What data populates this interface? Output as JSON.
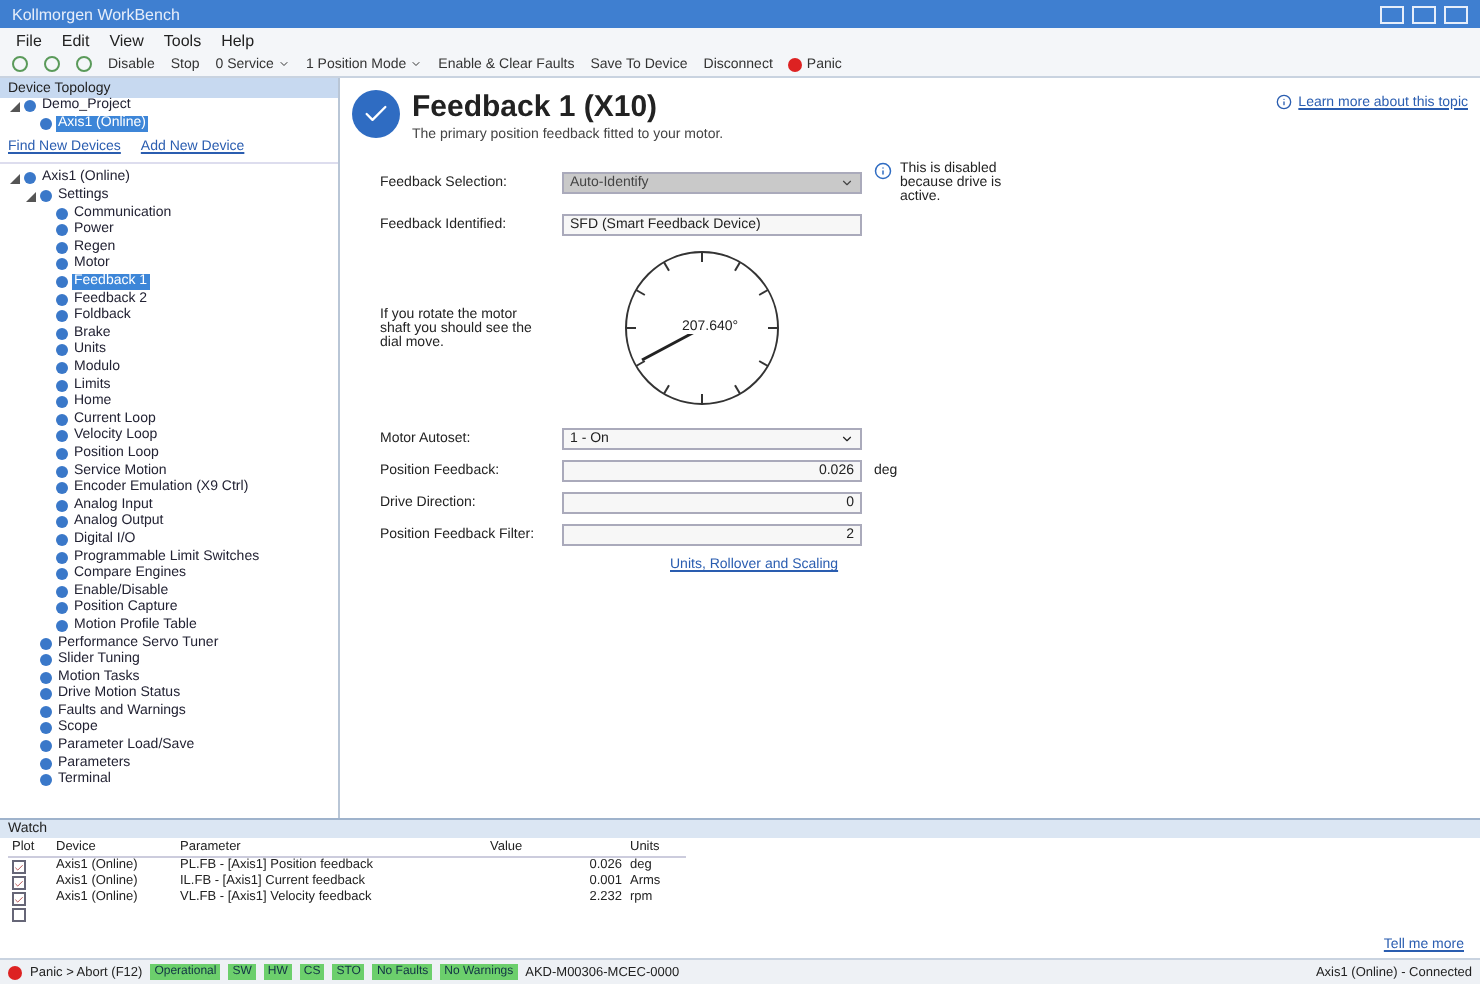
{
  "window": {
    "title": "Kollmorgen WorkBench"
  },
  "menu": [
    "File",
    "Edit",
    "View",
    "Tools",
    "Help"
  ],
  "toolbar": [
    {
      "label": "Disable",
      "kind": "text"
    },
    {
      "label": "Stop",
      "kind": "text"
    },
    {
      "label": "0 Service",
      "kind": "dropdown"
    },
    {
      "label": "1 Position Mode",
      "kind": "dropdown"
    },
    {
      "label": "Enable & Clear Faults",
      "kind": "text"
    },
    {
      "label": "Save To Device",
      "kind": "text"
    },
    {
      "label": "Disconnect",
      "kind": "text"
    },
    {
      "label": "Panic",
      "kind": "panic"
    }
  ],
  "sidebar": {
    "title": "Device Topology",
    "project": [
      {
        "label": "Demo_Project",
        "selected": false,
        "expanded": true,
        "children": [
          {
            "label": "Axis1 (Online)",
            "selected": true,
            "expanded": false
          }
        ]
      }
    ],
    "links": [
      "Find New Devices",
      "Add New Device"
    ],
    "tree": [
      {
        "label": "Axis1 (Online)",
        "selected": false,
        "expanded": true,
        "children": [
          {
            "label": "Settings",
            "selected": false,
            "expanded": true,
            "children": [
              {
                "label": "Communication",
                "selected": false,
                "expanded": false
              },
              {
                "label": "Power",
                "selected": false,
                "expanded": false
              },
              {
                "label": "Regen",
                "selected": false,
                "expanded": false
              },
              {
                "label": "Motor",
                "selected": false,
                "expanded": false
              },
              {
                "label": "Feedback 1",
                "selected": true,
                "expanded": false
              },
              {
                "label": "Feedback 2",
                "selected": false,
                "expanded": false
              },
              {
                "label": "Foldback",
                "selected": false,
                "expanded": false
              },
              {
                "label": "Brake",
                "selected": false,
                "expanded": false
              },
              {
                "label": "Units",
                "selected": false,
                "expanded": false
              },
              {
                "label": "Modulo",
                "selected": false,
                "expanded": false
              },
              {
                "label": "Limits",
                "selected": false,
                "expanded": false
              },
              {
                "label": "Home",
                "selected": false,
                "expanded": false
              },
              {
                "label": "Current Loop",
                "selected": false,
                "expanded": false
              },
              {
                "label": "Velocity Loop",
                "selected": false,
                "expanded": false
              },
              {
                "label": "Position Loop",
                "selected": false,
                "expanded": false
              },
              {
                "label": "Service Motion",
                "selected": false,
                "expanded": false
              },
              {
                "label": "Encoder Emulation (X9 Ctrl)",
                "selected": false,
                "expanded": false
              },
              {
                "label": "Analog Input",
                "selected": false,
                "expanded": false
              },
              {
                "label": "Analog Output",
                "selected": false,
                "expanded": false
              },
              {
                "label": "Digital I/O",
                "selected": false,
                "expanded": false
              },
              {
                "label": "Programmable Limit Switches",
                "selected": false,
                "expanded": false
              },
              {
                "label": "Compare Engines",
                "selected": false,
                "expanded": false
              },
              {
                "label": "Enable/Disable",
                "selected": false,
                "expanded": false
              },
              {
                "label": "Position Capture",
                "selected": false,
                "expanded": false
              },
              {
                "label": "Motion Profile Table",
                "selected": false,
                "expanded": false
              }
            ]
          },
          {
            "label": "Performance Servo Tuner",
            "selected": false,
            "expanded": false
          },
          {
            "label": "Slider Tuning",
            "selected": false,
            "expanded": false
          },
          {
            "label": "Motion Tasks",
            "selected": false,
            "expanded": false
          },
          {
            "label": "Drive Motion Status",
            "selected": false,
            "expanded": false
          },
          {
            "label": "Faults and Warnings",
            "selected": false,
            "expanded": false
          },
          {
            "label": "Scope",
            "selected": false,
            "expanded": false
          },
          {
            "label": "Parameter Load/Save",
            "selected": false,
            "expanded": false
          },
          {
            "label": "Parameters",
            "selected": false,
            "expanded": false
          },
          {
            "label": "Terminal",
            "selected": false,
            "expanded": false
          }
        ]
      }
    ]
  },
  "page": {
    "title": "Feedback 1 (X10)",
    "subtitle": "The primary position feedback fitted to your motor.",
    "help_link": "Learn more about this topic",
    "fields": [
      {
        "label": "Feedback Selection:",
        "value": "Auto-Identify",
        "disabled": true,
        "kind": "select",
        "note": "This is disabled because drive is active."
      },
      {
        "label": "Feedback Identified:",
        "value": "SFD (Smart Feedback Device)",
        "disabled": false,
        "kind": "text"
      }
    ],
    "dial": {
      "hint": "If you rotate the motor shaft you should see the dial move.",
      "reading": "207.640°"
    },
    "fields2": [
      {
        "label": "Motor Autoset:",
        "value": "1 - On",
        "kind": "select"
      },
      {
        "label": "Position Feedback:",
        "value": "0.026",
        "unit": "deg",
        "kind": "number"
      },
      {
        "label": "Drive Direction:",
        "value": "0",
        "kind": "number"
      },
      {
        "label": "Position Feedback Filter:",
        "value": "2",
        "kind": "number"
      }
    ],
    "link": "Units, Rollover and Scaling"
  },
  "watch": {
    "title": "Watch",
    "columns": [
      "Plot",
      "Device",
      "Parameter",
      "Value",
      "Units"
    ],
    "rows": [
      {
        "checked": true,
        "device": "Axis1 (Online)",
        "parameter": "PL.FB - [Axis1] Position feedback",
        "value": "0.026",
        "units": "deg"
      },
      {
        "checked": true,
        "device": "Axis1 (Online)",
        "parameter": "IL.FB - [Axis1] Current feedback",
        "value": "0.001",
        "units": "Arms"
      },
      {
        "checked": true,
        "device": "Axis1 (Online)",
        "parameter": "VL.FB - [Axis1] Velocity feedback",
        "value": "2.232",
        "units": "rpm"
      },
      {
        "checked": false
      }
    ],
    "link": "Tell me more"
  },
  "status_bar": {
    "panic": "Panic > Abort (F12)",
    "badges": [
      "Operational",
      "SW",
      "HW",
      "CS",
      "STO",
      "No Faults",
      "No Warnings"
    ],
    "model": "AKD-M00306-MCEC-0000",
    "connection": "Axis1 (Online) - Connected"
  }
}
